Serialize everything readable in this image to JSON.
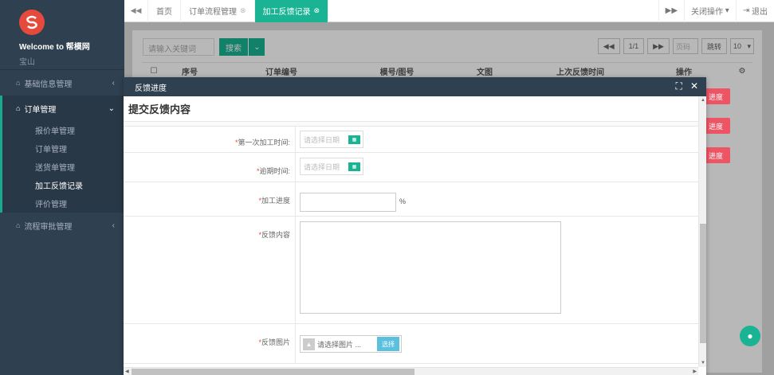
{
  "sidebar": {
    "welcome": "Welcome to 帮模网",
    "username": "宝山",
    "menu": [
      {
        "label": "基础信息管理",
        "arrow": "‹"
      },
      {
        "label": "订单管理",
        "arrow": "⌄",
        "items": [
          "报价单管理",
          "订单管理",
          "送货单管理",
          "加工反馈记录",
          "评价管理"
        ]
      },
      {
        "label": "流程审批管理",
        "arrow": "‹"
      }
    ]
  },
  "tabs": {
    "home": "首页",
    "items": [
      "订单流程管理",
      "加工反馈记录"
    ],
    "close_ops": "关闭操作",
    "logout": "退出"
  },
  "list": {
    "search_placeholder": "请输入关键词",
    "search_btn": "搜索",
    "page_info": "1/1",
    "page_placeholder": "页码",
    "jump": "跳转",
    "page_size": "10",
    "columns": [
      "序号",
      "订单编号",
      "模号/图号",
      "文图",
      "上次反馈时间",
      "操作"
    ],
    "row_action": "进度"
  },
  "modal": {
    "header": "反馈进度",
    "title": "提交反馈内容",
    "fields": {
      "first_time": "第一次加工时间:",
      "delay_time": "逾期时间:",
      "progress": "加工进度",
      "content": "反馈内容",
      "images": "反馈图片"
    },
    "date_placeholder": "请选择日期",
    "percent": "%",
    "file_placeholder": "请选择图片 ...",
    "file_btn": "选择"
  },
  "colors": {
    "accent": "#1ab394",
    "sidebar": "#2f4050",
    "danger": "#ed5565"
  }
}
